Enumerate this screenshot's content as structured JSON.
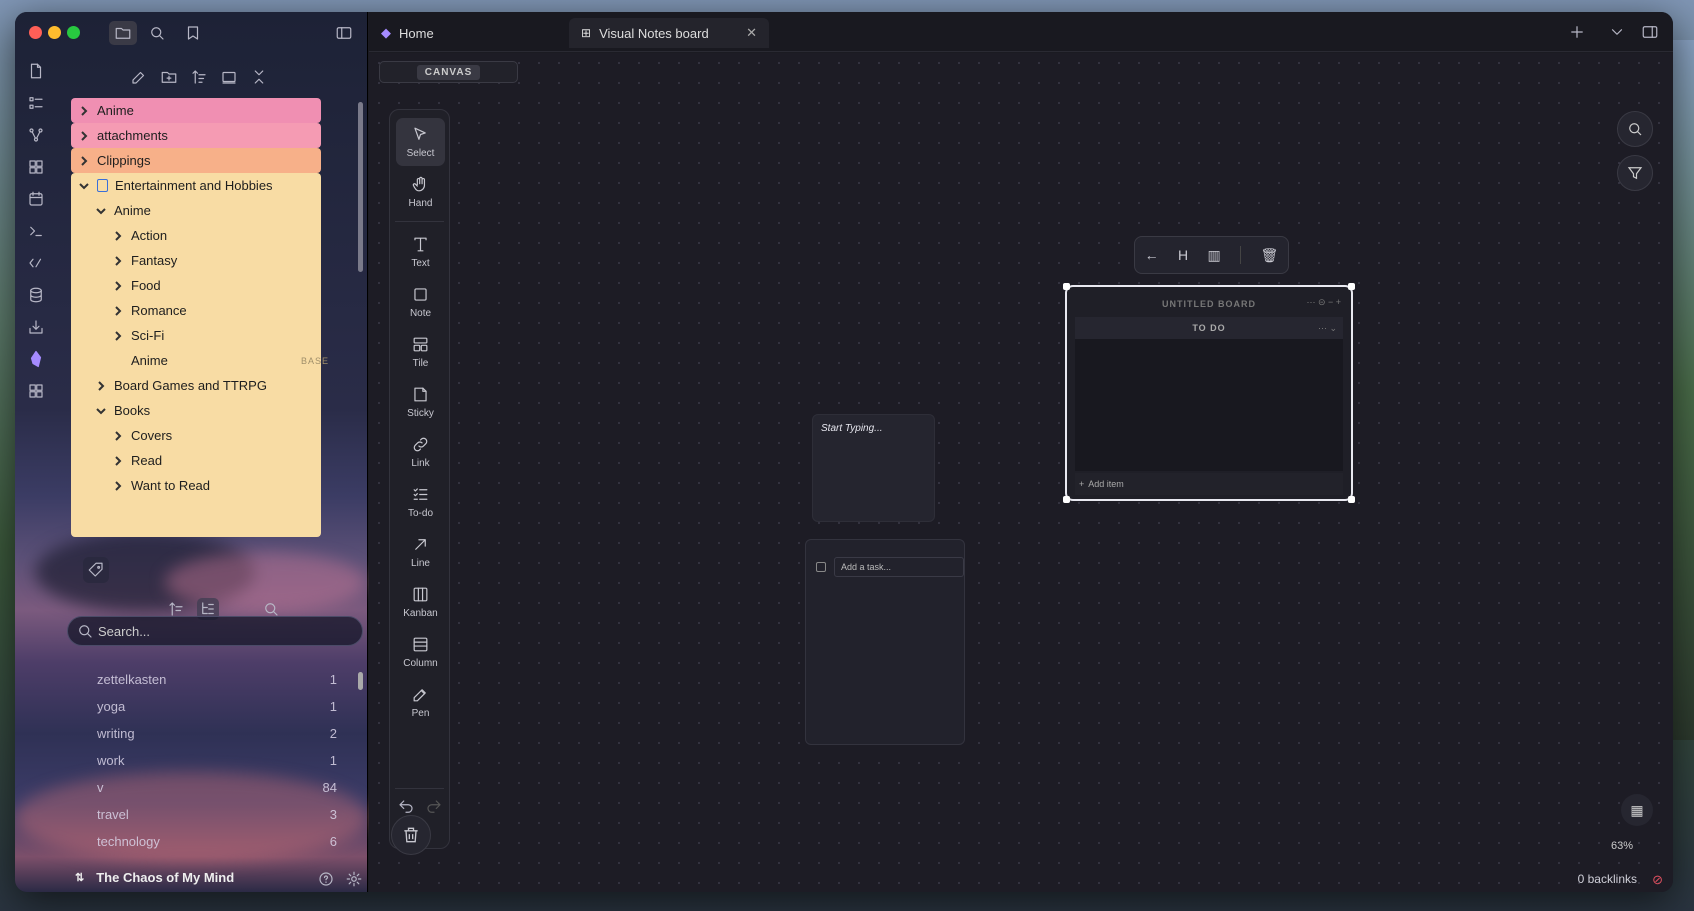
{
  "app": {
    "accent": "#a58bff"
  },
  "sidebar": {
    "folders": [
      {
        "label": "Anime",
        "color": "#f08fb2",
        "level": 0,
        "chevron": "right"
      },
      {
        "label": "attachments",
        "color": "#f59bb3",
        "level": 0,
        "chevron": "right"
      },
      {
        "label": "Clippings",
        "color": "#f7b089",
        "level": 0,
        "chevron": "right"
      },
      {
        "label": "Entertainment and Hobbies",
        "color": "#f8dca4",
        "level": 0,
        "chevron": "down",
        "icon": "book-icon"
      },
      {
        "label": "Anime",
        "color": "#f8dca4",
        "level": 1,
        "chevron": "down"
      },
      {
        "label": "Action",
        "color": "#f8dca4",
        "level": 2,
        "chevron": "right"
      },
      {
        "label": "Fantasy",
        "color": "#f8dca4",
        "level": 2,
        "chevron": "right"
      },
      {
        "label": "Food",
        "color": "#f8dca4",
        "level": 2,
        "chevron": "right"
      },
      {
        "label": "Romance",
        "color": "#f8dca4",
        "level": 2,
        "chevron": "right"
      },
      {
        "label": "Sci-Fi",
        "color": "#f8dca4",
        "level": 2,
        "chevron": "right"
      },
      {
        "label": "Anime",
        "color": "#f8dca4",
        "level": 2,
        "chevron": "none",
        "badge": "BASE"
      },
      {
        "label": "Board Games and TTRPG",
        "color": "#f8dca4",
        "level": 1,
        "chevron": "right"
      },
      {
        "label": "Books",
        "color": "#f8dca4",
        "level": 1,
        "chevron": "down"
      },
      {
        "label": "Covers",
        "color": "#f8dca4",
        "level": 2,
        "chevron": "right"
      },
      {
        "label": "Read",
        "color": "#f8dca4",
        "level": 2,
        "chevron": "right"
      },
      {
        "label": "Want to Read",
        "color": "#f8dca4",
        "level": 2,
        "chevron": "right"
      }
    ],
    "search_placeholder": "Search...",
    "tags": [
      {
        "name": "zettelkasten",
        "count": "1"
      },
      {
        "name": "yoga",
        "count": "1"
      },
      {
        "name": "writing",
        "count": "2"
      },
      {
        "name": "work",
        "count": "1"
      },
      {
        "name": "v",
        "count": "84"
      },
      {
        "name": "travel",
        "count": "3"
      },
      {
        "name": "technology",
        "count": "6"
      }
    ],
    "vault_name": "The Chaos of My Mind"
  },
  "tabs": [
    {
      "label": "Home"
    },
    {
      "label": "Visual Notes board"
    }
  ],
  "canvas": {
    "header_label": "CANVAS",
    "tools": [
      {
        "label": "Select",
        "icon": "cursor-icon"
      },
      {
        "label": "Hand",
        "icon": "hand-icon"
      },
      {
        "label": "Text",
        "icon": "text-icon"
      },
      {
        "label": "Note",
        "icon": "note-icon"
      },
      {
        "label": "Tile",
        "icon": "tile-icon"
      },
      {
        "label": "Sticky",
        "icon": "sticky-icon"
      },
      {
        "label": "Link",
        "icon": "link-icon"
      },
      {
        "label": "To-do",
        "icon": "todo-icon"
      },
      {
        "label": "Line",
        "icon": "line-icon"
      },
      {
        "label": "Kanban",
        "icon": "kanban-icon"
      },
      {
        "label": "Column",
        "icon": "column-icon"
      },
      {
        "label": "Pen",
        "icon": "pen-icon"
      }
    ],
    "sticky_placeholder": "Start Typing...",
    "todo_placeholder": "Add a task...",
    "board": {
      "title": "UNTITLED BOARD",
      "column": "TO DO",
      "add_item": "Add item"
    },
    "float_toolbar": {
      "heading_label": "H"
    }
  },
  "status": {
    "zoom": "63%",
    "backlinks": "0 backlinks"
  }
}
